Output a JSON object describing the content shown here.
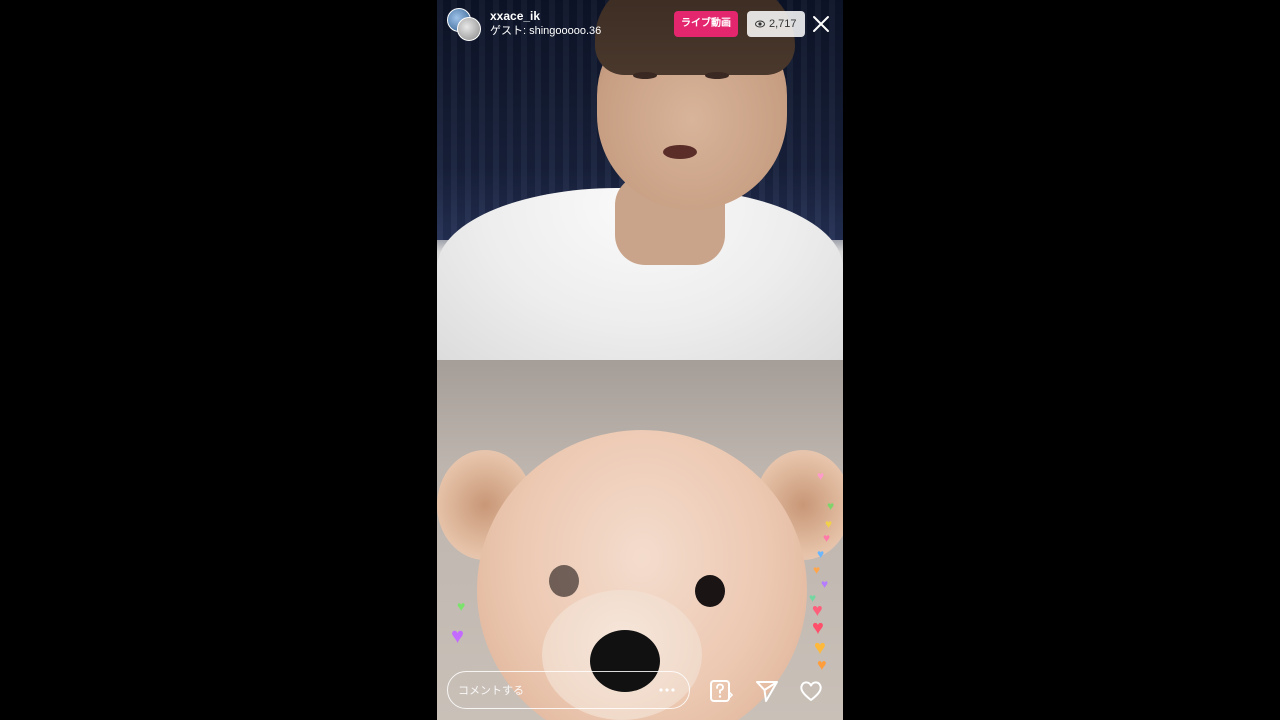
{
  "header": {
    "username": "xxace_ik",
    "guest_line": "ゲスト: shingooooo.36",
    "live_label": "ライブ動画",
    "viewer_count": "2,717"
  },
  "footer": {
    "comment_placeholder": "コメントする"
  },
  "icons": {
    "viewers": "eye-icon",
    "close": "close-icon",
    "more": "more-icon",
    "question": "question-icon",
    "send": "send-icon",
    "like": "heart-icon"
  },
  "colors": {
    "live_badge": "#e4266f",
    "background": "#000000"
  }
}
